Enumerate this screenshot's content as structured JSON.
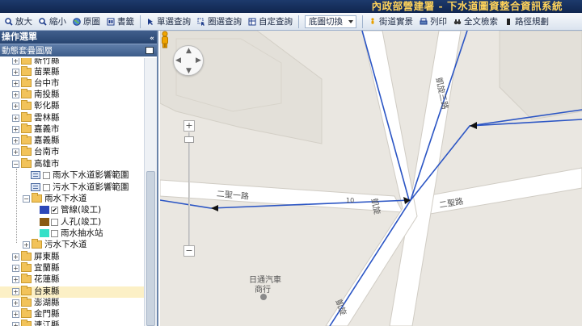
{
  "header": {
    "title": "內政部營建署 - 下水道圖資整合資訊系統"
  },
  "toolbar": {
    "zoom_in": "放大",
    "zoom_out": "縮小",
    "full_extent": "原圖",
    "bookmark": "書籤",
    "single_query": "單選查詢",
    "box_query": "圈選查詢",
    "custom_query": "自定查詢",
    "basemap_switch": "底圖切換",
    "street_view": "街道實景",
    "print": "列印",
    "fulltext_search": "全文檢索",
    "route_planning": "路徑規劃"
  },
  "sidebar": {
    "panel_title": "操作選單",
    "sub_title": "動態套疊圖層",
    "tree": [
      {
        "label": "新竹縣"
      },
      {
        "label": "苗栗縣"
      },
      {
        "label": "台中市"
      },
      {
        "label": "南投縣"
      },
      {
        "label": "彰化縣"
      },
      {
        "label": "雲林縣"
      },
      {
        "label": "嘉義市"
      },
      {
        "label": "嘉義縣"
      },
      {
        "label": "台南市"
      },
      {
        "label": "高雄市"
      },
      {
        "label": "雨水下水道影響範圍"
      },
      {
        "label": "污水下水道影響範圍"
      },
      {
        "label": "雨水下水道"
      },
      {
        "label": "管線(竣工)"
      },
      {
        "label": "人孔(竣工)"
      },
      {
        "label": "雨水抽水站"
      },
      {
        "label": "污水下水道"
      },
      {
        "label": "屏東縣"
      },
      {
        "label": "宜蘭縣"
      },
      {
        "label": "花蓮縣"
      },
      {
        "label": "台東縣"
      },
      {
        "label": "澎湖縣"
      },
      {
        "label": "金門縣"
      },
      {
        "label": "連江縣"
      }
    ]
  },
  "map": {
    "road_1": "二聖一路",
    "road_2": "二聖路",
    "road_3": "凱旋三路",
    "road_4": "凱旋",
    "road_5": "凱旋",
    "poi_1": "日通汽車",
    "poi_2": "商行",
    "number_1": "10"
  },
  "colors": {
    "header_bg": "#10264f",
    "title_text": "#ffd35a",
    "pipe_line": "#2b55c4",
    "map_bg": "#eae7e1",
    "road_fill": "#ffffff",
    "legend_pipe": "#2c47b8",
    "legend_manhole": "#8a5a12",
    "legend_station": "#35e0c8"
  }
}
